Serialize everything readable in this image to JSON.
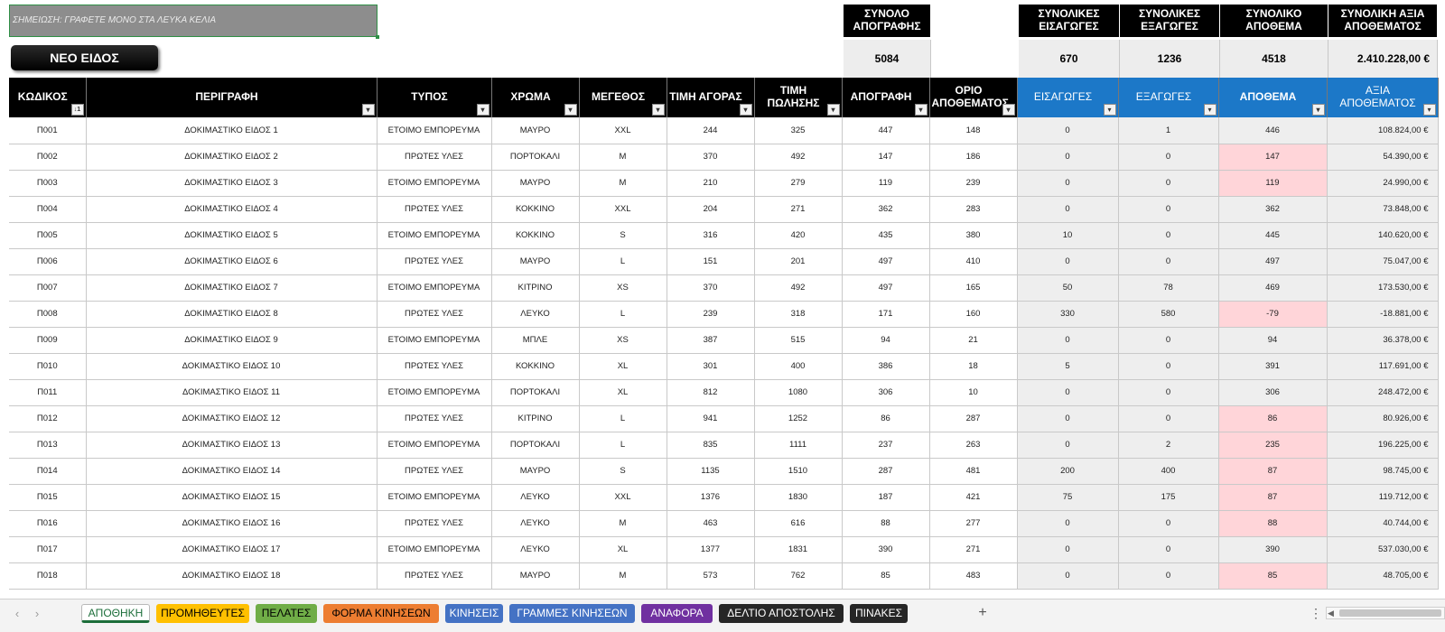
{
  "note": "ΣΗΜΕΙΩΣΗ: ΓΡΑΦΕΤΕ ΜΟΝΟ ΣΤΑ ΛΕΥΚΑ ΚΕΛΙΑ",
  "new_item_button": "ΝΕΟ ΕΙΔΟΣ",
  "summary": {
    "inventory_label": "ΣΥΝΟΛΟ ΑΠΟΓΡΑΦΗΣ",
    "inventory_value": "5084",
    "imports_label": "ΣΥΝΟΛΙΚΕΣ ΕΙΣΑΓΩΓΕΣ",
    "imports_value": "670",
    "exports_label": "ΣΥΝΟΛΙΚΕΣ ΕΞΑΓΩΓΕΣ",
    "exports_value": "1236",
    "stock_label": "ΣΥΝΟΛΙΚΟ ΑΠΟΘΕΜΑ",
    "stock_value": "4518",
    "stock_value_label": "ΣΥΝΟΛΙΚΗ ΑΞΙΑ ΑΠΟΘΕΜΑΤΟΣ",
    "stock_value_value": "2.410.228,00 €"
  },
  "columns": [
    "ΚΩΔΙΚΟΣ",
    "ΠΕΡΙΓΡΑΦΗ",
    "ΤΥΠΟΣ",
    "ΧΡΩΜΑ",
    "ΜΕΓΕΘΟΣ",
    "ΤΙΜΗ ΑΓΟΡΑΣ",
    "ΤΙΜΗ ΠΩΛΗΣΗΣ",
    "ΑΠΟΓΡΑΦΗ",
    "ΟΡΙΟ ΑΠΟΘΕΜΑΤΟΣ",
    "ΕΙΣΑΓΩΓΕΣ",
    "ΕΞΑΓΩΓΕΣ",
    "ΑΠΟΘΕΜΑ",
    "ΑΞΙΑ ΑΠΟΘΕΜΑΤΟΣ"
  ],
  "sort_indicator": "↓1",
  "rows": [
    [
      "Π001",
      "ΔΟΚΙΜΑΣΤΙΚΟ ΕΙΔΟΣ 1",
      "ΕΤΟΙΜΟ ΕΜΠΟΡΕΥΜΑ",
      "ΜΑΥΡΟ",
      "XXL",
      "244",
      "325",
      "447",
      "148",
      "0",
      "1",
      "446",
      "108.824,00 €"
    ],
    [
      "Π002",
      "ΔΟΚΙΜΑΣΤΙΚΟ ΕΙΔΟΣ 2",
      "ΠΡΩΤΕΣ ΥΛΕΣ",
      "ΠΟΡΤΟΚΑΛΙ",
      "M",
      "370",
      "492",
      "147",
      "186",
      "0",
      "0",
      "147",
      "54.390,00 €"
    ],
    [
      "Π003",
      "ΔΟΚΙΜΑΣΤΙΚΟ ΕΙΔΟΣ 3",
      "ΕΤΟΙΜΟ ΕΜΠΟΡΕΥΜΑ",
      "ΜΑΥΡΟ",
      "M",
      "210",
      "279",
      "119",
      "239",
      "0",
      "0",
      "119",
      "24.990,00 €"
    ],
    [
      "Π004",
      "ΔΟΚΙΜΑΣΤΙΚΟ ΕΙΔΟΣ 4",
      "ΠΡΩΤΕΣ ΥΛΕΣ",
      "ΚΟΚΚΙΝΟ",
      "XXL",
      "204",
      "271",
      "362",
      "283",
      "0",
      "0",
      "362",
      "73.848,00 €"
    ],
    [
      "Π005",
      "ΔΟΚΙΜΑΣΤΙΚΟ ΕΙΔΟΣ 5",
      "ΕΤΟΙΜΟ ΕΜΠΟΡΕΥΜΑ",
      "ΚΟΚΚΙΝΟ",
      "S",
      "316",
      "420",
      "435",
      "380",
      "10",
      "0",
      "445",
      "140.620,00 €"
    ],
    [
      "Π006",
      "ΔΟΚΙΜΑΣΤΙΚΟ ΕΙΔΟΣ 6",
      "ΠΡΩΤΕΣ ΥΛΕΣ",
      "ΜΑΥΡΟ",
      "L",
      "151",
      "201",
      "497",
      "410",
      "0",
      "0",
      "497",
      "75.047,00 €"
    ],
    [
      "Π007",
      "ΔΟΚΙΜΑΣΤΙΚΟ ΕΙΔΟΣ 7",
      "ΕΤΟΙΜΟ ΕΜΠΟΡΕΥΜΑ",
      "ΚΙΤΡΙΝΟ",
      "XS",
      "370",
      "492",
      "497",
      "165",
      "50",
      "78",
      "469",
      "173.530,00 €"
    ],
    [
      "Π008",
      "ΔΟΚΙΜΑΣΤΙΚΟ ΕΙΔΟΣ 8",
      "ΠΡΩΤΕΣ ΥΛΕΣ",
      "ΛΕΥΚΟ",
      "L",
      "239",
      "318",
      "171",
      "160",
      "330",
      "580",
      "-79",
      "-18.881,00 €"
    ],
    [
      "Π009",
      "ΔΟΚΙΜΑΣΤΙΚΟ ΕΙΔΟΣ 9",
      "ΕΤΟΙΜΟ ΕΜΠΟΡΕΥΜΑ",
      "ΜΠΛΕ",
      "XS",
      "387",
      "515",
      "94",
      "21",
      "0",
      "0",
      "94",
      "36.378,00 €"
    ],
    [
      "Π010",
      "ΔΟΚΙΜΑΣΤΙΚΟ ΕΙΔΟΣ 10",
      "ΠΡΩΤΕΣ ΥΛΕΣ",
      "ΚΟΚΚΙΝΟ",
      "XL",
      "301",
      "400",
      "386",
      "18",
      "5",
      "0",
      "391",
      "117.691,00 €"
    ],
    [
      "Π011",
      "ΔΟΚΙΜΑΣΤΙΚΟ ΕΙΔΟΣ 11",
      "ΕΤΟΙΜΟ ΕΜΠΟΡΕΥΜΑ",
      "ΠΟΡΤΟΚΑΛΙ",
      "XL",
      "812",
      "1080",
      "306",
      "10",
      "0",
      "0",
      "306",
      "248.472,00 €"
    ],
    [
      "Π012",
      "ΔΟΚΙΜΑΣΤΙΚΟ ΕΙΔΟΣ 12",
      "ΠΡΩΤΕΣ ΥΛΕΣ",
      "ΚΙΤΡΙΝΟ",
      "L",
      "941",
      "1252",
      "86",
      "287",
      "0",
      "0",
      "86",
      "80.926,00 €"
    ],
    [
      "Π013",
      "ΔΟΚΙΜΑΣΤΙΚΟ ΕΙΔΟΣ 13",
      "ΕΤΟΙΜΟ ΕΜΠΟΡΕΥΜΑ",
      "ΠΟΡΤΟΚΑΛΙ",
      "L",
      "835",
      "1111",
      "237",
      "263",
      "0",
      "2",
      "235",
      "196.225,00 €"
    ],
    [
      "Π014",
      "ΔΟΚΙΜΑΣΤΙΚΟ ΕΙΔΟΣ 14",
      "ΠΡΩΤΕΣ ΥΛΕΣ",
      "ΜΑΥΡΟ",
      "S",
      "1135",
      "1510",
      "287",
      "481",
      "200",
      "400",
      "87",
      "98.745,00 €"
    ],
    [
      "Π015",
      "ΔΟΚΙΜΑΣΤΙΚΟ ΕΙΔΟΣ 15",
      "ΕΤΟΙΜΟ ΕΜΠΟΡΕΥΜΑ",
      "ΛΕΥΚΟ",
      "XXL",
      "1376",
      "1830",
      "187",
      "421",
      "75",
      "175",
      "87",
      "119.712,00 €"
    ],
    [
      "Π016",
      "ΔΟΚΙΜΑΣΤΙΚΟ ΕΙΔΟΣ 16",
      "ΠΡΩΤΕΣ ΥΛΕΣ",
      "ΛΕΥΚΟ",
      "M",
      "463",
      "616",
      "88",
      "277",
      "0",
      "0",
      "88",
      "40.744,00 €"
    ],
    [
      "Π017",
      "ΔΟΚΙΜΑΣΤΙΚΟ ΕΙΔΟΣ 17",
      "ΕΤΟΙΜΟ ΕΜΠΟΡΕΥΜΑ",
      "ΛΕΥΚΟ",
      "XL",
      "1377",
      "1831",
      "390",
      "271",
      "0",
      "0",
      "390",
      "537.030,00 €"
    ],
    [
      "Π018",
      "ΔΟΚΙΜΑΣΤΙΚΟ ΕΙΔΟΣ 18",
      "ΠΡΩΤΕΣ ΥΛΕΣ",
      "ΜΑΥΡΟ",
      "M",
      "573",
      "762",
      "85",
      "483",
      "0",
      "0",
      "85",
      "48.705,00 €"
    ]
  ],
  "sheet_tabs": [
    {
      "label": "ΑΠΟΘΗΚΗ",
      "color": "#ffffff",
      "active": true
    },
    {
      "label": "ΠΡΟΜΗΘΕΥΤΕΣ",
      "color": "#ffc000"
    },
    {
      "label": "ΠΕΛΑΤΕΣ",
      "color": "#70ad47"
    },
    {
      "label": "ΦΟΡΜΑ ΚΙΝΗΣΕΩΝ",
      "color": "#ed7d31"
    },
    {
      "label": "ΚΙΝΗΣΕΙΣ",
      "color": "#4472c4"
    },
    {
      "label": "ΓΡΑΜΜΕΣ ΚΙΝΗΣΕΩΝ",
      "color": "#4472c4"
    },
    {
      "label": "ΑΝΑΦΟΡΑ",
      "color": "#7030a0"
    },
    {
      "label": "ΔΕΛΤΙΟ ΑΠΟΣΤΟΛΗΣ",
      "color": "#262626"
    },
    {
      "label": "ΠΙΝΑΚΕΣ",
      "color": "#262626"
    }
  ],
  "add_sheet": "+",
  "icons": {
    "filter": "dropdown-filter-icon",
    "nav_prev": "chevron-left-icon",
    "nav_next": "chevron-right-icon",
    "more": "more-dots-icon"
  },
  "colors": {
    "header_black": "#000000",
    "header_blue": "#1c78c8",
    "low_stock": "#ffd5d9",
    "computed_gray": "#eeeeee"
  }
}
